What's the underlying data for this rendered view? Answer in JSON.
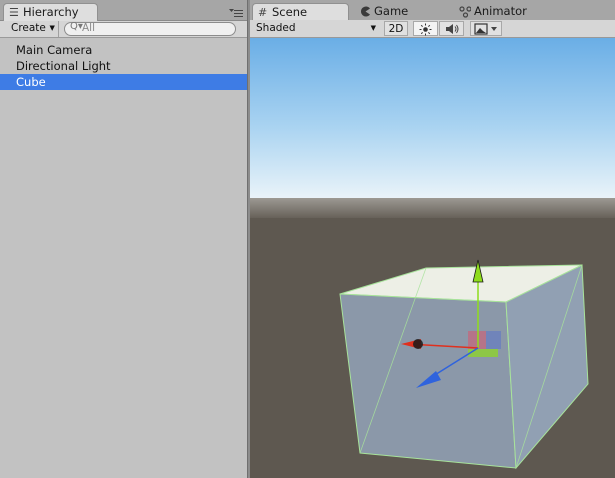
{
  "hierarchy": {
    "tab_label": "Hierarchy",
    "create_label": "Create",
    "search_placeholder": "All",
    "items": [
      {
        "label": "Main Camera",
        "selected": false
      },
      {
        "label": "Directional Light",
        "selected": false
      },
      {
        "label": "Cube",
        "selected": true
      }
    ]
  },
  "scene": {
    "tabs": [
      {
        "label": "Scene",
        "icon": "grid-icon",
        "active": true
      },
      {
        "label": "Game",
        "icon": "pacman-icon",
        "active": false
      },
      {
        "label": "Animator",
        "icon": "animator-icon",
        "active": false
      }
    ],
    "toolbar": {
      "draw_mode": "Shaded",
      "mode_2d_label": "2D",
      "lighting_icon": "sun-icon",
      "audio_icon": "speaker-icon",
      "effects_icon": "image-icon"
    }
  },
  "colors": {
    "selection": "#3e7ce5",
    "sky_top": "#6aaee6",
    "ground": "#5e5850",
    "gizmo_x": "#e0301e",
    "gizmo_y": "#8fdc1c",
    "gizmo_z": "#2f63dd"
  }
}
